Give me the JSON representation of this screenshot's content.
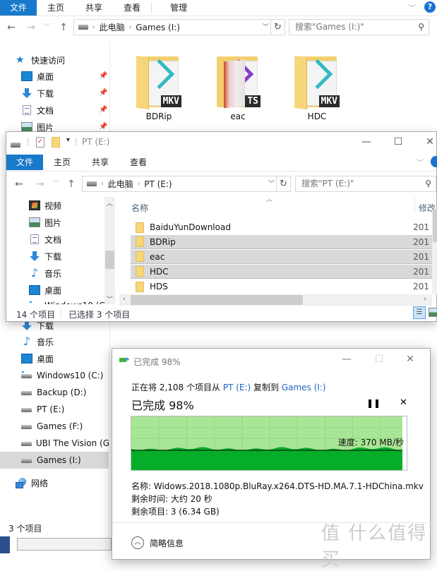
{
  "back_window": {
    "ribbon_tabs": [
      "文件",
      "主页",
      "共享",
      "查看",
      "管理"
    ],
    "breadcrumb": [
      "此电脑",
      "Games (I:)"
    ],
    "search_placeholder": "搜索\"Games (I:)\"",
    "quick_access_label": "快速访问",
    "quick_access": [
      {
        "label": "桌面",
        "icon": "desktop-icon"
      },
      {
        "label": "下载",
        "icon": "download-icon"
      },
      {
        "label": "文档",
        "icon": "document-icon"
      },
      {
        "label": "图片",
        "icon": "pictures-icon"
      }
    ],
    "folders": [
      {
        "name": "BDRip",
        "badge": "MKV"
      },
      {
        "name": "eac",
        "badge": "TS"
      },
      {
        "name": "HDC",
        "badge": "MKV"
      }
    ],
    "nav_lower": [
      {
        "label": "下载",
        "icon": "download-icon"
      },
      {
        "label": "音乐",
        "icon": "music-icon"
      },
      {
        "label": "桌面",
        "icon": "desktop-icon"
      },
      {
        "label": "Windows10 (C:)",
        "icon": "windows-drive-icon"
      },
      {
        "label": "Backup (D:)",
        "icon": "drive-icon"
      },
      {
        "label": "PT (E:)",
        "icon": "drive-icon"
      },
      {
        "label": "Games (F:)",
        "icon": "drive-icon"
      },
      {
        "label": "UBI The Vision (G",
        "icon": "drive-icon"
      },
      {
        "label": "Games (I:)",
        "icon": "drive-icon",
        "selected": true
      }
    ],
    "network_label": "网络",
    "status": "3 个项目"
  },
  "pt_window": {
    "title": "PT (E:)",
    "ribbon_tabs": [
      "文件",
      "主页",
      "共享",
      "查看"
    ],
    "breadcrumb": [
      "此电脑",
      "PT (E:)"
    ],
    "search_placeholder": "搜索\"PT (E:)\"",
    "nav_items": [
      {
        "label": "视频",
        "icon": "video-icon"
      },
      {
        "label": "图片",
        "icon": "pictures-icon"
      },
      {
        "label": "文档",
        "icon": "document-icon"
      },
      {
        "label": "下载",
        "icon": "download-icon"
      },
      {
        "label": "音乐",
        "icon": "music-icon"
      },
      {
        "label": "桌面",
        "icon": "desktop-icon"
      },
      {
        "label": "Windows10 (C",
        "icon": "windows-drive-icon"
      }
    ],
    "columns": {
      "name": "名称",
      "modified": "修改"
    },
    "rows": [
      {
        "name": "BaiduYunDownload",
        "date": "201",
        "selected": false
      },
      {
        "name": "BDRip",
        "date": "201",
        "selected": true
      },
      {
        "name": "eac",
        "date": "201",
        "selected": true
      },
      {
        "name": "HDC",
        "date": "201",
        "selected": true
      },
      {
        "name": "HDS",
        "date": "201",
        "selected": false
      }
    ],
    "status_count": "14 个项目",
    "status_selected": "已选择 3 个项目"
  },
  "copy_dialog": {
    "title": "已完成 98%",
    "line_prefix": "正在将 2,108 个项目从 ",
    "source": "PT (E:)",
    "line_mid": " 复制到 ",
    "dest": "Games (I:)",
    "progress_text": "已完成 98%",
    "progress_percent": 98,
    "speed": "速度: 370 MB/秒",
    "name_label": "名称: Widows.2018.1080p.BluRay.x264.DTS-HD.MA.7.1-HDChina.mkv",
    "time_left": "剩余时间: 大约 20 秒",
    "items_left": "剩余项目: 3 (6.34 GB)",
    "details_toggle": "简略信息",
    "pause_icon": "pause-icon",
    "cancel_icon": "close-icon"
  },
  "watermark": "值 什么值得买"
}
